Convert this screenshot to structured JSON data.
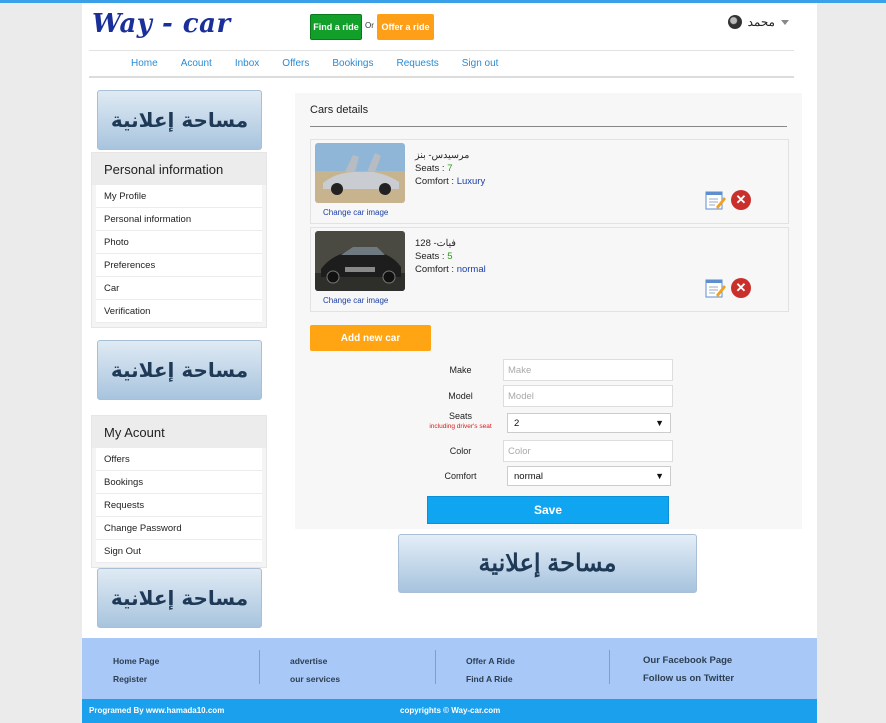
{
  "header": {
    "logo": "Way - car",
    "find_ride": "Find a ride",
    "or": "Or",
    "offer_ride": "Offer a ride",
    "username": "محمد"
  },
  "nav": [
    "Home",
    "Acount",
    "Inbox",
    "Offers",
    "Bookings",
    "Requests",
    "Sign out"
  ],
  "ads": {
    "label": "مساحة إعلانية"
  },
  "personal_panel": {
    "title": "Personal information",
    "items": [
      "My Profile",
      "Personal information",
      "Photo",
      "Preferences",
      "Car",
      "Verification"
    ]
  },
  "account_panel": {
    "title": "My Acount",
    "items": [
      "Offers",
      "Bookings",
      "Requests",
      "Change Password",
      "Sign Out"
    ]
  },
  "main": {
    "title": "Cars details",
    "cars": [
      {
        "name": "مرسيدس- بنز",
        "seats_label": "Seats :",
        "seats": "7",
        "comfort_label": "Comfort :",
        "comfort": "Luxury",
        "change_image": "Change car image"
      },
      {
        "name": "فيات- 128",
        "seats_label": "Seats :",
        "seats": "5",
        "comfort_label": "Comfort :",
        "comfort": "normal",
        "change_image": "Change car image"
      }
    ],
    "add_car": "Add new car",
    "form": {
      "make_label": "Make",
      "make_placeholder": "Make",
      "model_label": "Model",
      "model_placeholder": "Model",
      "seats_label": "Seats",
      "seats_note": "including driver's seat",
      "seats_value": "2",
      "color_label": "Color",
      "color_placeholder": "Color",
      "comfort_label": "Comfort",
      "comfort_value": "normal",
      "save": "Save"
    }
  },
  "footer": {
    "col1": [
      "Home Page",
      "Register"
    ],
    "col2": [
      "advertise",
      "our services"
    ],
    "col3": [
      "Offer A Ride",
      "Find A Ride"
    ],
    "col4": [
      "Our Facebook Page",
      "Follow us on Twitter"
    ],
    "programmed": "Programed By www.hamada10.com",
    "copyright": "copyrights © Way-car.com"
  },
  "colors": {
    "accent": "#1aa0ec",
    "green": "#12a02a",
    "orange": "#ff9f18",
    "footer_bg": "#a8c8f8"
  }
}
